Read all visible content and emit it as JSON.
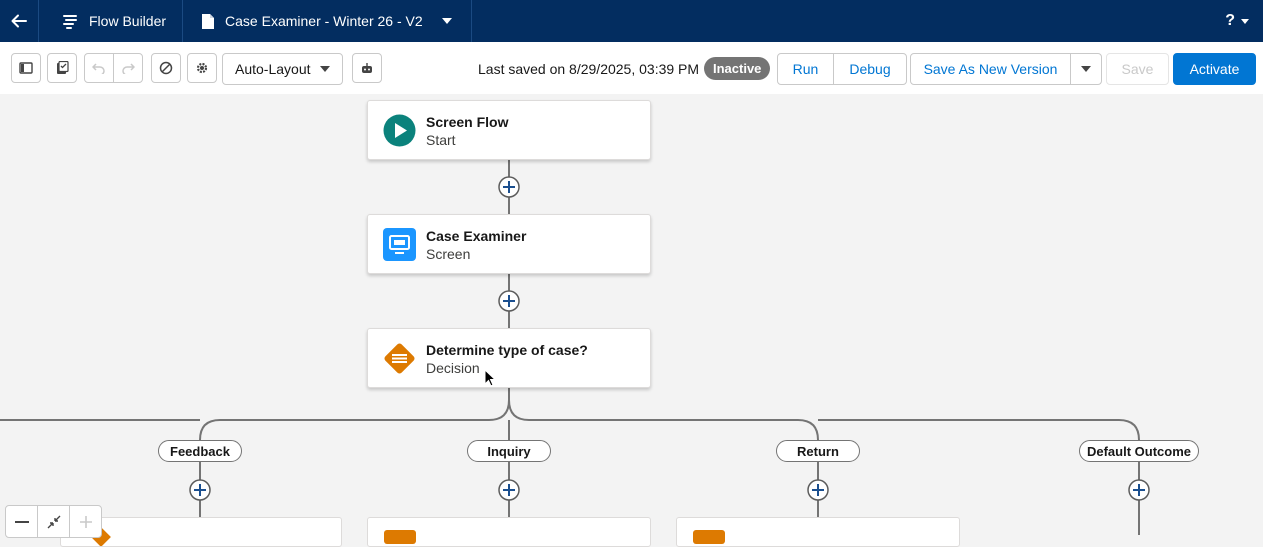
{
  "topbar": {
    "app_name": "Flow Builder",
    "flow_title": "Case Examiner - Winter 26 - V2",
    "help_label": "?"
  },
  "toolbar": {
    "layout_mode": "Auto-Layout",
    "last_saved": "Last saved on 8/29/2025, 03:39 PM",
    "status_badge": "Inactive",
    "run_label": "Run",
    "debug_label": "Debug",
    "save_as_new_label": "Save As New Version",
    "save_label": "Save",
    "activate_label": "Activate"
  },
  "canvas": {
    "nodes": [
      {
        "title": "Screen Flow",
        "type": "Start",
        "icon": "play-icon"
      },
      {
        "title": "Case Examiner",
        "type": "Screen",
        "icon": "screen-icon"
      },
      {
        "title": "Determine type of case?",
        "type": "Decision",
        "icon": "decision-icon"
      }
    ],
    "outcomes": [
      "Feedback",
      "Inquiry",
      "Return",
      "Default Outcome"
    ]
  },
  "colors": {
    "header_bg": "#032d60",
    "brand_blue": "#0176d3",
    "start_green": "#0b827c",
    "screen_blue": "#1b96ff",
    "decision_orange": "#dd7a01",
    "badge_gray": "#747474"
  }
}
